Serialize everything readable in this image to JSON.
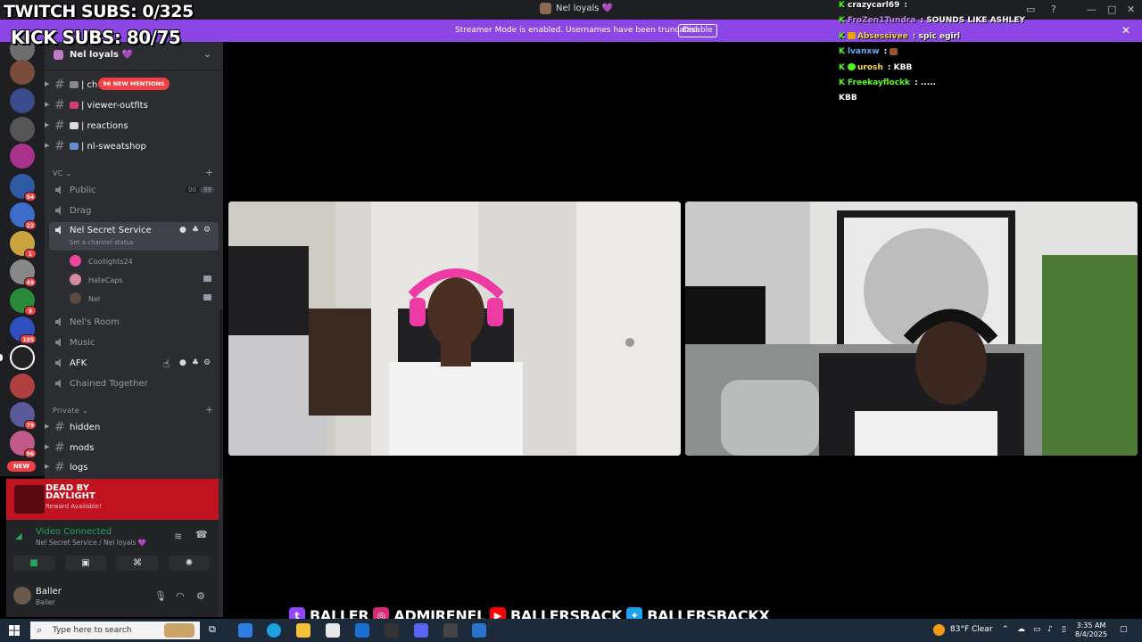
{
  "window": {
    "title": "Nel loyals 💜"
  },
  "banner": {
    "message": "Streamer Mode is enabled. Usernames have been truncated.",
    "button": "Disable"
  },
  "overlay": {
    "twitch_subs": "TWITCH SUBS: 0/325",
    "kick_subs": "KICK SUBS: 80/75"
  },
  "server_rail": {
    "badges": [
      "54",
      "22",
      "1",
      "49",
      "9",
      "105",
      "79",
      "99",
      "96"
    ],
    "new_label": "NEW"
  },
  "sidebar": {
    "server_name": "Nel loyals 💜",
    "mentions_badge": "96 NEW MENTIONS",
    "text_channels": [
      {
        "label": "| ch"
      },
      {
        "label": "| viewer-outfits"
      },
      {
        "label": "| reactions"
      },
      {
        "label": "| nl-sweatshop"
      }
    ],
    "vc_category": "VC",
    "voice_channels": {
      "public": "Public",
      "public_counts": [
        "00",
        "99"
      ],
      "drag": "Drag",
      "secret": "Nel Secret Service",
      "secret_status": "Set a channel status",
      "users": [
        "Coollights24",
        "HateCaps",
        "Nel"
      ],
      "nels_room": "Nel's Room",
      "music": "Music",
      "afk": "AFK",
      "chained": "Chained Together"
    },
    "private_category": "Private",
    "private_channels": [
      "hidden",
      "mods",
      "logs"
    ]
  },
  "reward": {
    "game": "DEAD BY DAYLIGHT",
    "text": "Reward Available!"
  },
  "voice": {
    "status": "Video Connected",
    "location": "Nel Secret Service / Nel loyals 💜"
  },
  "user": {
    "name": "Baller",
    "status": "Baller"
  },
  "chat": [
    {
      "user": "crazycarl69",
      "sep": " : ",
      "msg": ""
    },
    {
      "user": "FroZen1Tundra",
      "sep": " : ",
      "msg": "SOUNDS LIKE ASHLEY"
    },
    {
      "user": "Absessivee",
      "sep": " : ",
      "msg": "spic egirl"
    },
    {
      "user": "lvanxw",
      "sep": " : ",
      "msg": ""
    },
    {
      "user": "urosh",
      "sep": " : ",
      "msg": "KBB"
    },
    {
      "user": "Freekayflockk",
      "sep": " : ",
      "msg": "....."
    },
    {
      "user": "",
      "sep": "",
      "msg": "KBB"
    }
  ],
  "socials": {
    "twitch": "BALLER",
    "instagram": "ADMIRENEL",
    "youtube": "BALLERSBACK",
    "twitter": "BALLERSBACKX"
  },
  "taskbar": {
    "search_placeholder": "Type here to search",
    "weather": "83°F  Clear",
    "time": "3:35 AM",
    "date": "8/4/2025"
  },
  "colors": {
    "banner": "#8c46e6",
    "sidebar": "#2b2d31",
    "rail": "#1e1f22",
    "connected": "#23a55a",
    "reward": "#c0121f",
    "kick_green": "#53fc18"
  }
}
